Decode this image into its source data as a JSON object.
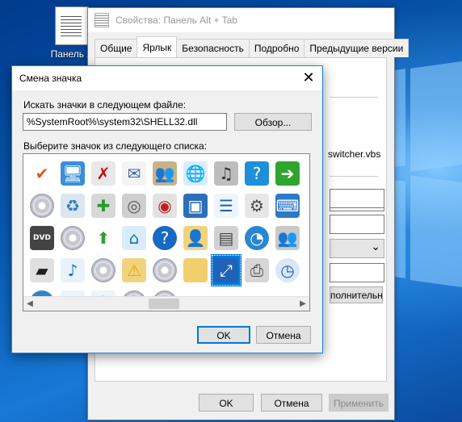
{
  "desktop": {
    "icon_label": "Панель А"
  },
  "properties_window": {
    "title": "Свойства: Панель Alt + Tab",
    "tabs": [
      "Общие",
      "Ярлык",
      "Безопасность",
      "Подробно",
      "Предыдущие версии"
    ],
    "active_tab": "Ярлык",
    "target_field_value": "switcher.vbs",
    "advanced_button_label": "полнительно...",
    "ok_label": "OK",
    "cancel_label": "Отмена",
    "apply_label": "Применить"
  },
  "change_icon_dialog": {
    "title": "Смена значка",
    "close_glyph": "✕",
    "file_label": "Искать значки в следующем файле:",
    "file_path": "%SystemRoot%\\system32\\SHELL32.dll",
    "browse_label": "Обзор...",
    "list_label": "Выберите значок из следующего списка:",
    "ok_label": "OK",
    "cancel_label": "Отмена",
    "scroll_left": "◀",
    "scroll_right": "▶",
    "icons": [
      {
        "name": "checkmark-icon",
        "glyph": "✔",
        "fg": "#e0561a",
        "bg": "transparent"
      },
      {
        "name": "folder-network-icon",
        "glyph": "🖥",
        "fg": "#ffffff",
        "bg": "#3a8fd8"
      },
      {
        "name": "document-delete-icon",
        "glyph": "✗",
        "fg": "#d00000",
        "bg": "#e8e8e8"
      },
      {
        "name": "envelope-icon",
        "glyph": "✉",
        "fg": "#3b6aa8",
        "bg": "#f4f4f4"
      },
      {
        "name": "users-icon",
        "glyph": "👥",
        "fg": "#2d6b2d",
        "bg": "#c9b28a"
      },
      {
        "name": "network-globe-icon",
        "glyph": "🌐",
        "fg": "#1a6fc0",
        "bg": "#d8ecff"
      },
      {
        "name": "speaker-icon",
        "glyph": "♫",
        "fg": "#333333",
        "bg": "#bdbdbd"
      },
      {
        "name": "help-person-icon",
        "glyph": "?",
        "fg": "#ffffff",
        "bg": "#1e8fd8"
      },
      {
        "name": "green-arrow-icon",
        "glyph": "➔",
        "fg": "#ffffff",
        "bg": "#2fa52f"
      },
      {
        "name": "cd-rom-icon",
        "glyph": "",
        "fg": "#000000",
        "bg": "transparent",
        "disc": true
      },
      {
        "name": "recycle-bin-icon",
        "glyph": "♻",
        "fg": "#2a7fc9",
        "bg": "#dde6ee"
      },
      {
        "name": "add-drive-icon",
        "glyph": "✚",
        "fg": "#2b9a2b",
        "bg": "#d8d8d8"
      },
      {
        "name": "disk-cleanup-icon",
        "glyph": "◎",
        "fg": "#555555",
        "bg": "#cfcfcf"
      },
      {
        "name": "red-disc-icon",
        "glyph": "◉",
        "fg": "#c02020",
        "bg": "#e2e2e2"
      },
      {
        "name": "monitor-settings-icon",
        "glyph": "▣",
        "fg": "#ffffff",
        "bg": "#2c6fb8"
      },
      {
        "name": "list-window-icon",
        "glyph": "☰",
        "fg": "#1f5fa8",
        "bg": "#eef4fb"
      },
      {
        "name": "gear-document-icon",
        "glyph": "⚙",
        "fg": "#4a4a4a",
        "bg": "#e6e6e6"
      },
      {
        "name": "computer-keyboard-icon",
        "glyph": "⌨",
        "fg": "#ffffff",
        "bg": "#2c79c8"
      },
      {
        "name": "dvd-drive-icon",
        "glyph": "DVD",
        "fg": "#ffffff",
        "bg": "#444444"
      },
      {
        "name": "cd-icon",
        "glyph": "",
        "fg": "#000000",
        "bg": "transparent",
        "disc": true
      },
      {
        "name": "up-arrow-icon",
        "glyph": "⬆",
        "fg": "#2f9f2f",
        "bg": "transparent"
      },
      {
        "name": "home-network-icon",
        "glyph": "⌂",
        "fg": "#1d69b5",
        "bg": "#d9ecfa"
      },
      {
        "name": "help-icon",
        "glyph": "?",
        "fg": "#ffffff",
        "bg": "#1769c2",
        "round": true
      },
      {
        "name": "user-folder-icon",
        "glyph": "👤",
        "fg": "#355e9c",
        "bg": "#f2d37d"
      },
      {
        "name": "media-icon",
        "glyph": "▤",
        "fg": "#444444",
        "bg": "#d0d0d0"
      },
      {
        "name": "pie-chart-icon",
        "glyph": "◔",
        "fg": "#ffffff",
        "bg": "#2a86d4",
        "round": true
      },
      {
        "name": "user-group-icon",
        "glyph": "👥",
        "fg": "#2d6b2d",
        "bg": "#c9c9c9"
      },
      {
        "name": "display-icon",
        "glyph": "▰",
        "fg": "#202020",
        "bg": "#e0e0e0"
      },
      {
        "name": "add-music-icon",
        "glyph": "♪",
        "fg": "#1a6fc0",
        "bg": "#e9f2fb"
      },
      {
        "name": "cd-rw-icon",
        "glyph": "",
        "fg": "#000000",
        "bg": "transparent",
        "disc": true
      },
      {
        "name": "warning-folder-icon",
        "glyph": "⚠",
        "fg": "#e7a100",
        "bg": "#f2d37d"
      },
      {
        "name": "disc-gray-icon",
        "glyph": "",
        "fg": "#000000",
        "bg": "transparent",
        "disc": true
      },
      {
        "name": "folder-icon",
        "glyph": "",
        "fg": "#000000",
        "bg": "#f2cf6d"
      },
      {
        "name": "fullscreen-icon",
        "glyph": "⤢",
        "fg": "#ffffff",
        "bg": "#1f63b8"
      },
      {
        "name": "printer-icon",
        "glyph": "⎙",
        "fg": "#444444",
        "bg": "#d6d6d6"
      },
      {
        "name": "clock-icon",
        "glyph": "◷",
        "fg": "#1e5fa8",
        "bg": "#d9e8f7",
        "round": true
      },
      {
        "name": "globe-icon",
        "glyph": "◍",
        "fg": "#ffffff",
        "bg": "#2b86d0",
        "round": true
      },
      {
        "name": "search-window-icon",
        "glyph": "⌕",
        "fg": "#1f5fa8",
        "bg": "#eef4fb"
      },
      {
        "name": "help-window-icon",
        "glyph": "?",
        "fg": "#1f5fa8",
        "bg": "#eef4fb"
      },
      {
        "name": "help-disc-icon",
        "glyph": "?",
        "fg": "#1f5fa8",
        "bg": "transparent",
        "disc": true
      },
      {
        "name": "dvd-rw-icon",
        "glyph": "",
        "fg": "#000000",
        "bg": "transparent",
        "disc": true
      }
    ]
  }
}
